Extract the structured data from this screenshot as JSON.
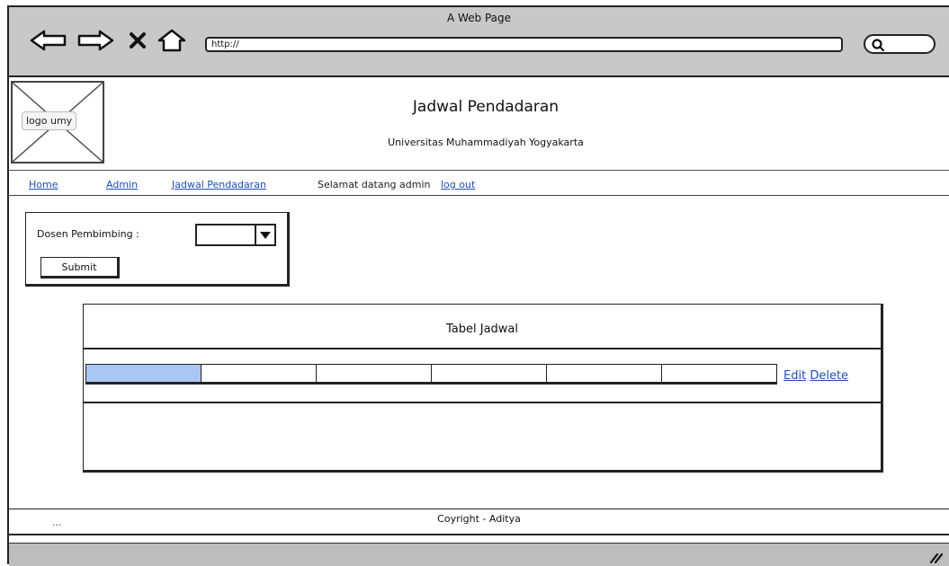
{
  "browser": {
    "window_title": "A Web Page",
    "url": "http://",
    "icons": [
      "back-arrow-icon",
      "forward-arrow-icon",
      "close-x-icon",
      "home-icon",
      "search-icon",
      "resize-grip-icon"
    ]
  },
  "header": {
    "logo_label": "logo umy",
    "title": "Jadwal Pendadaran",
    "subtitle": "Universitas Muhammadiyah Yogyakarta"
  },
  "nav": {
    "home": "Home",
    "admin": "Admin",
    "jadwal": "Jadwal Pendadaran",
    "welcome": "Selamat datang admin",
    "logout": "log out"
  },
  "form": {
    "label": "Dosen Pembimbing :",
    "select_value": "",
    "submit": "Submit"
  },
  "table": {
    "title": "Tabel Jadwal",
    "cells": [
      "",
      "",
      "",
      "",
      "",
      ""
    ],
    "edit": "Edit",
    "delete": "Delete"
  },
  "footer": {
    "dots": "...",
    "text": "Coyright - Aditya"
  },
  "colors": {
    "link": "#1f4fb5",
    "chrome": "#c8c8c8",
    "selected_cell": "#a9c6f4"
  }
}
